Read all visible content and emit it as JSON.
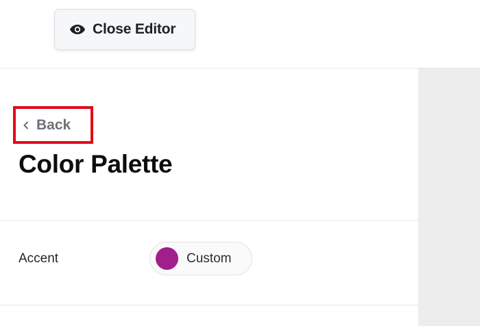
{
  "topbar": {
    "close_label": "Close Editor",
    "close_icon": "eye-icon"
  },
  "nav": {
    "back_label": "Back",
    "back_icon": "chevron-left-icon"
  },
  "page": {
    "title": "Color Palette"
  },
  "settings": {
    "accent": {
      "label": "Accent",
      "value_label": "Custom",
      "swatch_color": "#a11f8a"
    }
  },
  "colors": {
    "highlight_border": "#e20b17",
    "side_panel": "#ededee"
  }
}
